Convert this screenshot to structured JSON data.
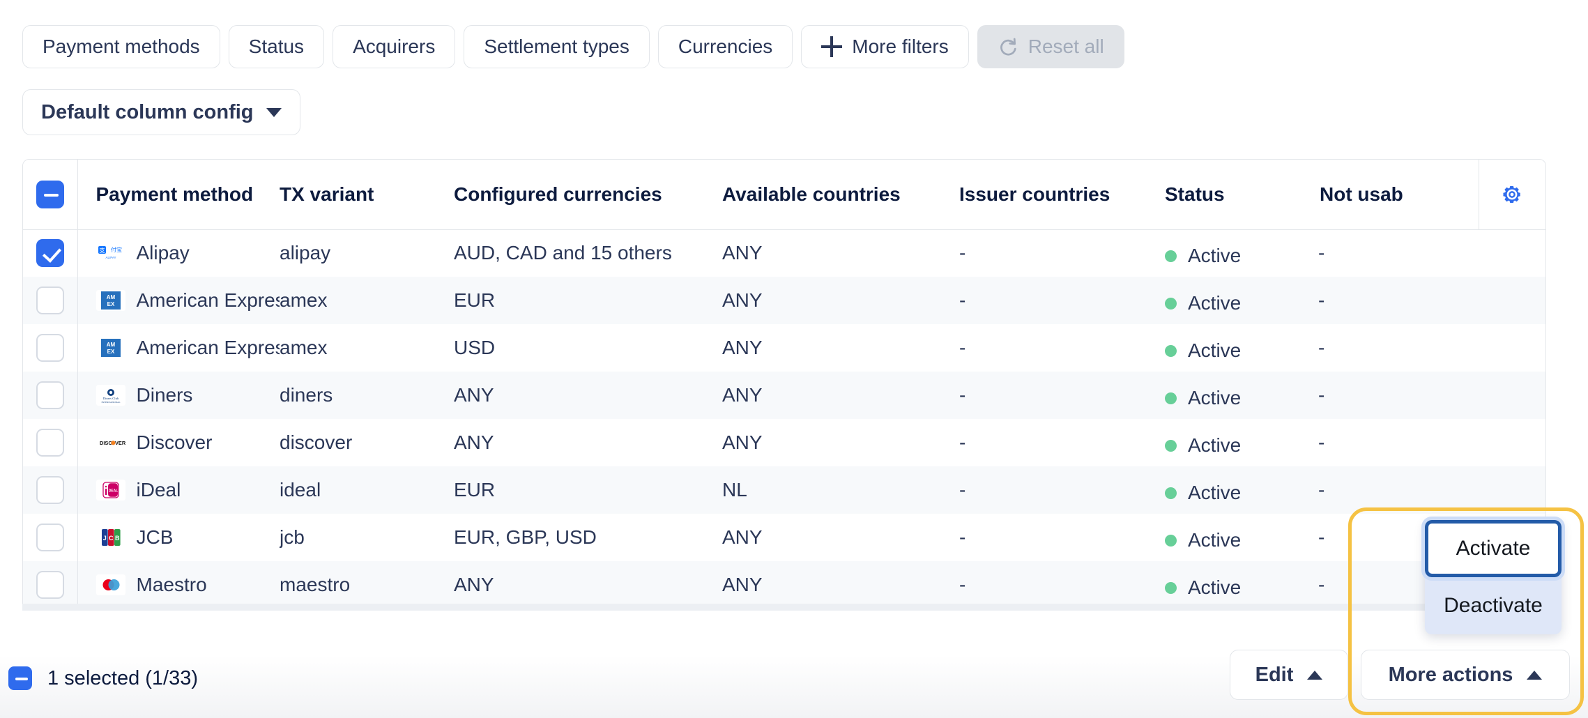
{
  "filters": {
    "chips": [
      {
        "label": "Payment methods",
        "icon": null,
        "disabled": false
      },
      {
        "label": "Status",
        "icon": null,
        "disabled": false
      },
      {
        "label": "Acquirers",
        "icon": null,
        "disabled": false
      },
      {
        "label": "Settlement types",
        "icon": null,
        "disabled": false
      },
      {
        "label": "Currencies",
        "icon": null,
        "disabled": false
      },
      {
        "label": "More filters",
        "icon": "plus-icon",
        "disabled": false
      },
      {
        "label": "Reset all",
        "icon": "reset-icon",
        "disabled": true
      }
    ]
  },
  "column_config": {
    "label": "Default column config",
    "icon": "chevron-down-icon"
  },
  "table": {
    "columns": [
      "Payment method",
      "TX variant",
      "Configured currencies",
      "Available countries",
      "Issuer countries",
      "Status",
      "Not usab"
    ],
    "settings_icon": "gear-icon",
    "header_checkbox_state": "indeterminate",
    "rows": [
      {
        "selected": true,
        "logo": "alipay-logo",
        "payment_method": "Alipay",
        "tx_variant": "alipay",
        "configured_currencies": "AUD, CAD and 15 others",
        "available_countries": "ANY",
        "issuer_countries": "-",
        "status": "Active",
        "not_usable": "-"
      },
      {
        "selected": false,
        "logo": "amex-logo",
        "payment_method": "American Express",
        "tx_variant": "amex",
        "configured_currencies": "EUR",
        "available_countries": "ANY",
        "issuer_countries": "-",
        "status": "Active",
        "not_usable": "-"
      },
      {
        "selected": false,
        "logo": "amex-logo",
        "payment_method": "American Express",
        "tx_variant": "amex",
        "configured_currencies": "USD",
        "available_countries": "ANY",
        "issuer_countries": "-",
        "status": "Active",
        "not_usable": "-"
      },
      {
        "selected": false,
        "logo": "diners-logo",
        "payment_method": "Diners",
        "tx_variant": "diners",
        "configured_currencies": "ANY",
        "available_countries": "ANY",
        "issuer_countries": "-",
        "status": "Active",
        "not_usable": "-"
      },
      {
        "selected": false,
        "logo": "discover-logo",
        "payment_method": "Discover",
        "tx_variant": "discover",
        "configured_currencies": "ANY",
        "available_countries": "ANY",
        "issuer_countries": "-",
        "status": "Active",
        "not_usable": "-"
      },
      {
        "selected": false,
        "logo": "ideal-logo",
        "payment_method": "iDeal",
        "tx_variant": "ideal",
        "configured_currencies": "EUR",
        "available_countries": "NL",
        "issuer_countries": "-",
        "status": "Active",
        "not_usable": "-"
      },
      {
        "selected": false,
        "logo": "jcb-logo",
        "payment_method": "JCB",
        "tx_variant": "jcb",
        "configured_currencies": "EUR, GBP, USD",
        "available_countries": "ANY",
        "issuer_countries": "-",
        "status": "Active",
        "not_usable": "-"
      },
      {
        "selected": false,
        "logo": "maestro-logo",
        "payment_method": "Maestro",
        "tx_variant": "maestro",
        "configured_currencies": "ANY",
        "available_countries": "ANY",
        "issuer_countries": "-",
        "status": "Active",
        "not_usable": "-"
      }
    ]
  },
  "footer": {
    "selection_text": "1 selected (1/33)",
    "selection_checkbox_state": "indeterminate",
    "edit_label": "Edit",
    "edit_icon": "chevron-up-icon",
    "more_actions_label": "More actions",
    "more_actions_icon": "chevron-up-icon"
  },
  "menu": {
    "items": [
      {
        "label": "Activate",
        "focused": true
      },
      {
        "label": "Deactivate",
        "focused": false
      }
    ]
  },
  "colors": {
    "accent_blue": "#2f6bed",
    "status_green": "#67cf98",
    "text_dark": "#2b3757",
    "heading_dark": "#0d1b3e",
    "border": "#e3e6ea",
    "row_alt": "#f7f9fb",
    "disabled_bg": "#e1e4e8",
    "disabled_text": "#a2abba",
    "menu_bg": "#dfe7f8",
    "focus_ring": "#235ba8",
    "highlight_orange": "#f5c243"
  }
}
